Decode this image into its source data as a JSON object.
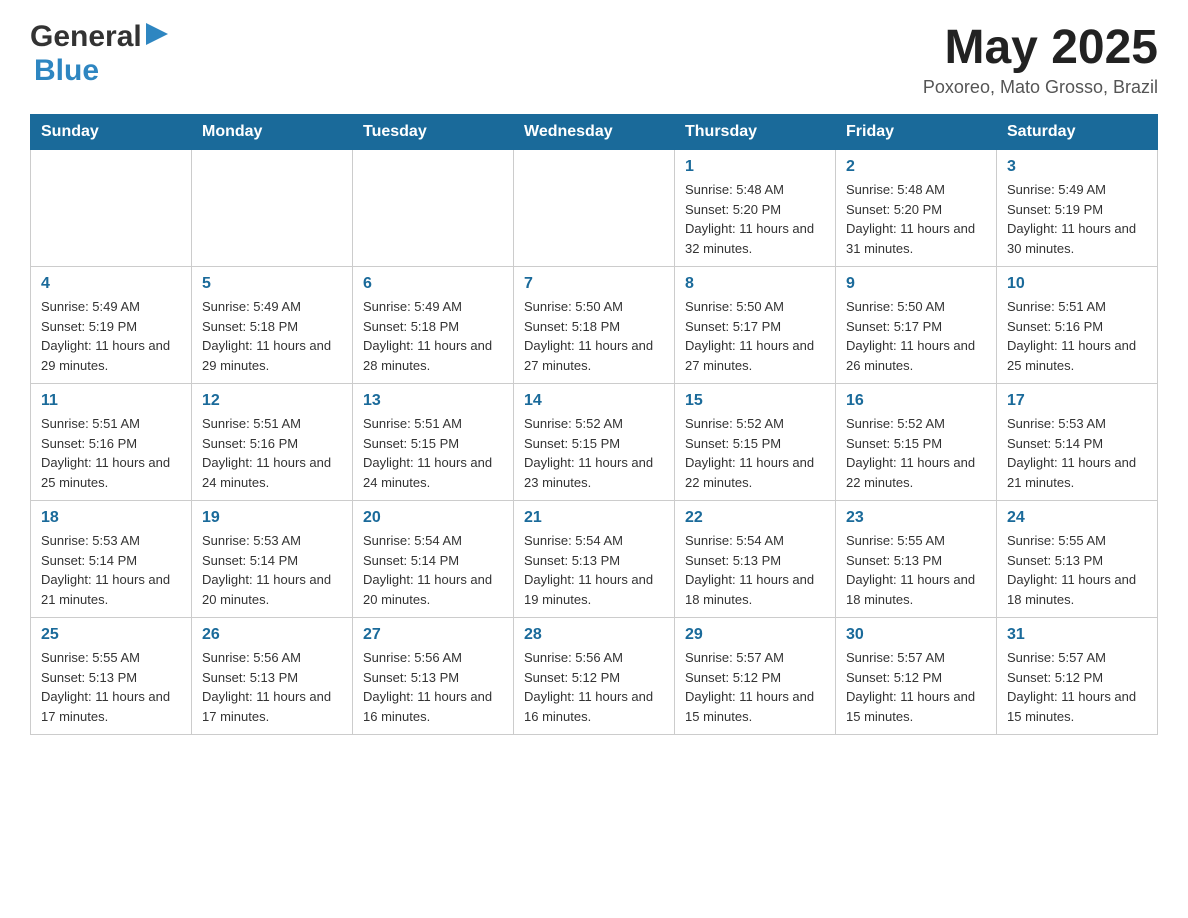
{
  "header": {
    "logo_general": "General",
    "logo_blue": "Blue",
    "month_year": "May 2025",
    "location": "Poxoreo, Mato Grosso, Brazil"
  },
  "weekdays": [
    "Sunday",
    "Monday",
    "Tuesday",
    "Wednesday",
    "Thursday",
    "Friday",
    "Saturday"
  ],
  "weeks": [
    [
      {
        "day": "",
        "sunrise": "",
        "sunset": "",
        "daylight": ""
      },
      {
        "day": "",
        "sunrise": "",
        "sunset": "",
        "daylight": ""
      },
      {
        "day": "",
        "sunrise": "",
        "sunset": "",
        "daylight": ""
      },
      {
        "day": "",
        "sunrise": "",
        "sunset": "",
        "daylight": ""
      },
      {
        "day": "1",
        "sunrise": "Sunrise: 5:48 AM",
        "sunset": "Sunset: 5:20 PM",
        "daylight": "Daylight: 11 hours and 32 minutes."
      },
      {
        "day": "2",
        "sunrise": "Sunrise: 5:48 AM",
        "sunset": "Sunset: 5:20 PM",
        "daylight": "Daylight: 11 hours and 31 minutes."
      },
      {
        "day": "3",
        "sunrise": "Sunrise: 5:49 AM",
        "sunset": "Sunset: 5:19 PM",
        "daylight": "Daylight: 11 hours and 30 minutes."
      }
    ],
    [
      {
        "day": "4",
        "sunrise": "Sunrise: 5:49 AM",
        "sunset": "Sunset: 5:19 PM",
        "daylight": "Daylight: 11 hours and 29 minutes."
      },
      {
        "day": "5",
        "sunrise": "Sunrise: 5:49 AM",
        "sunset": "Sunset: 5:18 PM",
        "daylight": "Daylight: 11 hours and 29 minutes."
      },
      {
        "day": "6",
        "sunrise": "Sunrise: 5:49 AM",
        "sunset": "Sunset: 5:18 PM",
        "daylight": "Daylight: 11 hours and 28 minutes."
      },
      {
        "day": "7",
        "sunrise": "Sunrise: 5:50 AM",
        "sunset": "Sunset: 5:18 PM",
        "daylight": "Daylight: 11 hours and 27 minutes."
      },
      {
        "day": "8",
        "sunrise": "Sunrise: 5:50 AM",
        "sunset": "Sunset: 5:17 PM",
        "daylight": "Daylight: 11 hours and 27 minutes."
      },
      {
        "day": "9",
        "sunrise": "Sunrise: 5:50 AM",
        "sunset": "Sunset: 5:17 PM",
        "daylight": "Daylight: 11 hours and 26 minutes."
      },
      {
        "day": "10",
        "sunrise": "Sunrise: 5:51 AM",
        "sunset": "Sunset: 5:16 PM",
        "daylight": "Daylight: 11 hours and 25 minutes."
      }
    ],
    [
      {
        "day": "11",
        "sunrise": "Sunrise: 5:51 AM",
        "sunset": "Sunset: 5:16 PM",
        "daylight": "Daylight: 11 hours and 25 minutes."
      },
      {
        "day": "12",
        "sunrise": "Sunrise: 5:51 AM",
        "sunset": "Sunset: 5:16 PM",
        "daylight": "Daylight: 11 hours and 24 minutes."
      },
      {
        "day": "13",
        "sunrise": "Sunrise: 5:51 AM",
        "sunset": "Sunset: 5:15 PM",
        "daylight": "Daylight: 11 hours and 24 minutes."
      },
      {
        "day": "14",
        "sunrise": "Sunrise: 5:52 AM",
        "sunset": "Sunset: 5:15 PM",
        "daylight": "Daylight: 11 hours and 23 minutes."
      },
      {
        "day": "15",
        "sunrise": "Sunrise: 5:52 AM",
        "sunset": "Sunset: 5:15 PM",
        "daylight": "Daylight: 11 hours and 22 minutes."
      },
      {
        "day": "16",
        "sunrise": "Sunrise: 5:52 AM",
        "sunset": "Sunset: 5:15 PM",
        "daylight": "Daylight: 11 hours and 22 minutes."
      },
      {
        "day": "17",
        "sunrise": "Sunrise: 5:53 AM",
        "sunset": "Sunset: 5:14 PM",
        "daylight": "Daylight: 11 hours and 21 minutes."
      }
    ],
    [
      {
        "day": "18",
        "sunrise": "Sunrise: 5:53 AM",
        "sunset": "Sunset: 5:14 PM",
        "daylight": "Daylight: 11 hours and 21 minutes."
      },
      {
        "day": "19",
        "sunrise": "Sunrise: 5:53 AM",
        "sunset": "Sunset: 5:14 PM",
        "daylight": "Daylight: 11 hours and 20 minutes."
      },
      {
        "day": "20",
        "sunrise": "Sunrise: 5:54 AM",
        "sunset": "Sunset: 5:14 PM",
        "daylight": "Daylight: 11 hours and 20 minutes."
      },
      {
        "day": "21",
        "sunrise": "Sunrise: 5:54 AM",
        "sunset": "Sunset: 5:13 PM",
        "daylight": "Daylight: 11 hours and 19 minutes."
      },
      {
        "day": "22",
        "sunrise": "Sunrise: 5:54 AM",
        "sunset": "Sunset: 5:13 PM",
        "daylight": "Daylight: 11 hours and 18 minutes."
      },
      {
        "day": "23",
        "sunrise": "Sunrise: 5:55 AM",
        "sunset": "Sunset: 5:13 PM",
        "daylight": "Daylight: 11 hours and 18 minutes."
      },
      {
        "day": "24",
        "sunrise": "Sunrise: 5:55 AM",
        "sunset": "Sunset: 5:13 PM",
        "daylight": "Daylight: 11 hours and 18 minutes."
      }
    ],
    [
      {
        "day": "25",
        "sunrise": "Sunrise: 5:55 AM",
        "sunset": "Sunset: 5:13 PM",
        "daylight": "Daylight: 11 hours and 17 minutes."
      },
      {
        "day": "26",
        "sunrise": "Sunrise: 5:56 AM",
        "sunset": "Sunset: 5:13 PM",
        "daylight": "Daylight: 11 hours and 17 minutes."
      },
      {
        "day": "27",
        "sunrise": "Sunrise: 5:56 AM",
        "sunset": "Sunset: 5:13 PM",
        "daylight": "Daylight: 11 hours and 16 minutes."
      },
      {
        "day": "28",
        "sunrise": "Sunrise: 5:56 AM",
        "sunset": "Sunset: 5:12 PM",
        "daylight": "Daylight: 11 hours and 16 minutes."
      },
      {
        "day": "29",
        "sunrise": "Sunrise: 5:57 AM",
        "sunset": "Sunset: 5:12 PM",
        "daylight": "Daylight: 11 hours and 15 minutes."
      },
      {
        "day": "30",
        "sunrise": "Sunrise: 5:57 AM",
        "sunset": "Sunset: 5:12 PM",
        "daylight": "Daylight: 11 hours and 15 minutes."
      },
      {
        "day": "31",
        "sunrise": "Sunrise: 5:57 AM",
        "sunset": "Sunset: 5:12 PM",
        "daylight": "Daylight: 11 hours and 15 minutes."
      }
    ]
  ]
}
